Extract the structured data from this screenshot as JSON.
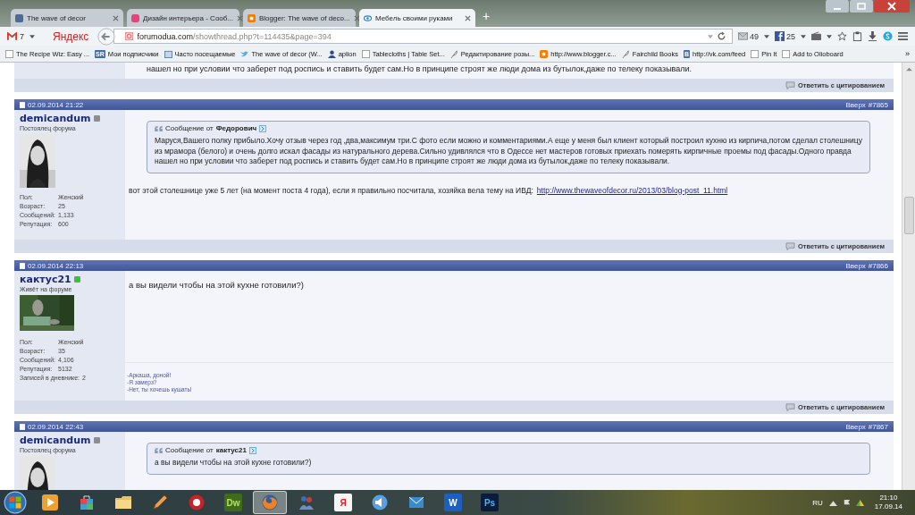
{
  "tabs": [
    {
      "title": "The wave of decor",
      "kind": "vk",
      "selected": false
    },
    {
      "title": "Дизайн интерьера - Сооб...",
      "kind": "pink",
      "selected": false
    },
    {
      "title": "Blogger: The wave of deco...",
      "kind": "blogger",
      "selected": false
    },
    {
      "title": "Мебель своими руками",
      "kind": "eye",
      "selected": true
    }
  ],
  "new_tab": "+",
  "navbar": {
    "mail_count": "7",
    "search_brand": "Яндекс",
    "url_host": "forumodua.com",
    "url_path": "/showthread.php?t=114435&page=394",
    "messages_count": "49",
    "facebook_count": "25"
  },
  "bookmarks": [
    {
      "label": "The Recipe Wiz: Easy ...",
      "kind": "page"
    },
    {
      "label": "Мои подписчики",
      "kind": "badge",
      "badge": "SR"
    },
    {
      "label": "Часто посещаемые",
      "kind": "folder"
    },
    {
      "label": "The wave of decor (W...",
      "kind": "bird"
    },
    {
      "label": "aplion",
      "kind": "person"
    },
    {
      "label": "Tablecloths | Table Set...",
      "kind": "page"
    },
    {
      "label": "Редактирование розы...",
      "kind": "feather"
    },
    {
      "label": "http://www.blogger.c...",
      "kind": "blogger"
    },
    {
      "label": "Fairchild Books",
      "kind": "feather"
    },
    {
      "label": "http://vk.com/feed",
      "kind": "badge",
      "badge": "B"
    },
    {
      "label": "Pin It",
      "kind": "page"
    },
    {
      "label": "Add to Olioboard",
      "kind": "page"
    }
  ],
  "bookmarks_more": "»",
  "previous_post": {
    "text": "нашел но при условии что заберет под роспись и ставить будет сам.Но в принципе строят же люди дома из бутылок,даже по телеку показывали.",
    "reply": "Ответить с цитированием"
  },
  "posts": [
    {
      "date": "02.09.2014 21:22",
      "top_link": "Вверх",
      "number": "#7865",
      "username": "demicandum",
      "online": false,
      "user_title": "Постоялец форума",
      "stats": [
        {
          "label": "Пол:",
          "value": "Женский"
        },
        {
          "label": "Возраст:",
          "value": "25"
        },
        {
          "label": "Сообщений:",
          "value": "1,133"
        },
        {
          "label": "Репутация:",
          "value": "600"
        }
      ],
      "quote": {
        "prefix": "Сообщение от",
        "author": "Федорович",
        "text": "Маруся,Вашего полку прибыло.Хочу отзыв через год ,два,максимум три.С фото если можно и комментариями.А еще у меня был клиент который построил кухню из кирпича,потом сделал столешницу из мрамора (белого) и очень долго искал фасады из натурального дерева.Сильно удивлялся что в Одессе нет мастеров готовых приехать померять кирпичные проемы под фасады.Одного правда нашел но при условии что заберет под роспись и ставить будет сам.Но в принципе строят же люди дома из бутылок,даже по телеку показывали."
      },
      "message": "вот этой столешнице уже 5 лет (на момент поста 4 года), если я правильно посчитала, хозяйка вела тему на ИВД:",
      "link": "http://www.thewaveofdecor.ru/2013/03/blog-post_11.html",
      "reply": "Ответить с цитированием"
    },
    {
      "date": "02.09.2014 22:13",
      "top_link": "Вверх",
      "number": "#7866",
      "username": "кактус21",
      "online": true,
      "user_title": "Живёт на форуме",
      "stats": [
        {
          "label": "Пол:",
          "value": "Женский"
        },
        {
          "label": "Возраст:",
          "value": "35"
        },
        {
          "label": "Сообщений:",
          "value": "4,106"
        },
        {
          "label": "Репутация:",
          "value": "5132"
        },
        {
          "label": "Записей в дневнике:",
          "value": "2"
        }
      ],
      "message": "а вы видели чтобы на этой кухне готовили?)",
      "signature": [
        "-Аркаша, доной!",
        "-Я замерз?",
        "-Нет, ты хочешь кушать!"
      ],
      "reply": "Ответить с цитированием"
    },
    {
      "date": "02.09.2014 22:43",
      "top_link": "Вверх",
      "number": "#7867",
      "username": "demicandum",
      "online": false,
      "user_title": "Постоялец форума",
      "quote": {
        "prefix": "Сообщение от",
        "author": "кактус21",
        "text": "а вы видели чтобы на этой кухне готовили?)"
      }
    }
  ],
  "taskbar": {
    "items": [
      {
        "kind": "media",
        "selected": false
      },
      {
        "kind": "bag",
        "selected": false
      },
      {
        "kind": "folder",
        "selected": false
      },
      {
        "kind": "pencil",
        "selected": false
      },
      {
        "kind": "redcircle",
        "selected": false
      },
      {
        "kind": "label",
        "label": "Dw",
        "selected": false
      },
      {
        "kind": "firefox",
        "selected": true
      },
      {
        "kind": "people",
        "selected": false
      },
      {
        "kind": "label",
        "label": "Я",
        "selected": false
      },
      {
        "kind": "speaker",
        "selected": false
      },
      {
        "kind": "mail",
        "selected": false
      },
      {
        "kind": "label",
        "label": "W",
        "selected": false
      },
      {
        "kind": "label",
        "label": "Ps",
        "selected": false
      }
    ],
    "language": "RU",
    "time": "21:10",
    "date": "17.09.14"
  }
}
